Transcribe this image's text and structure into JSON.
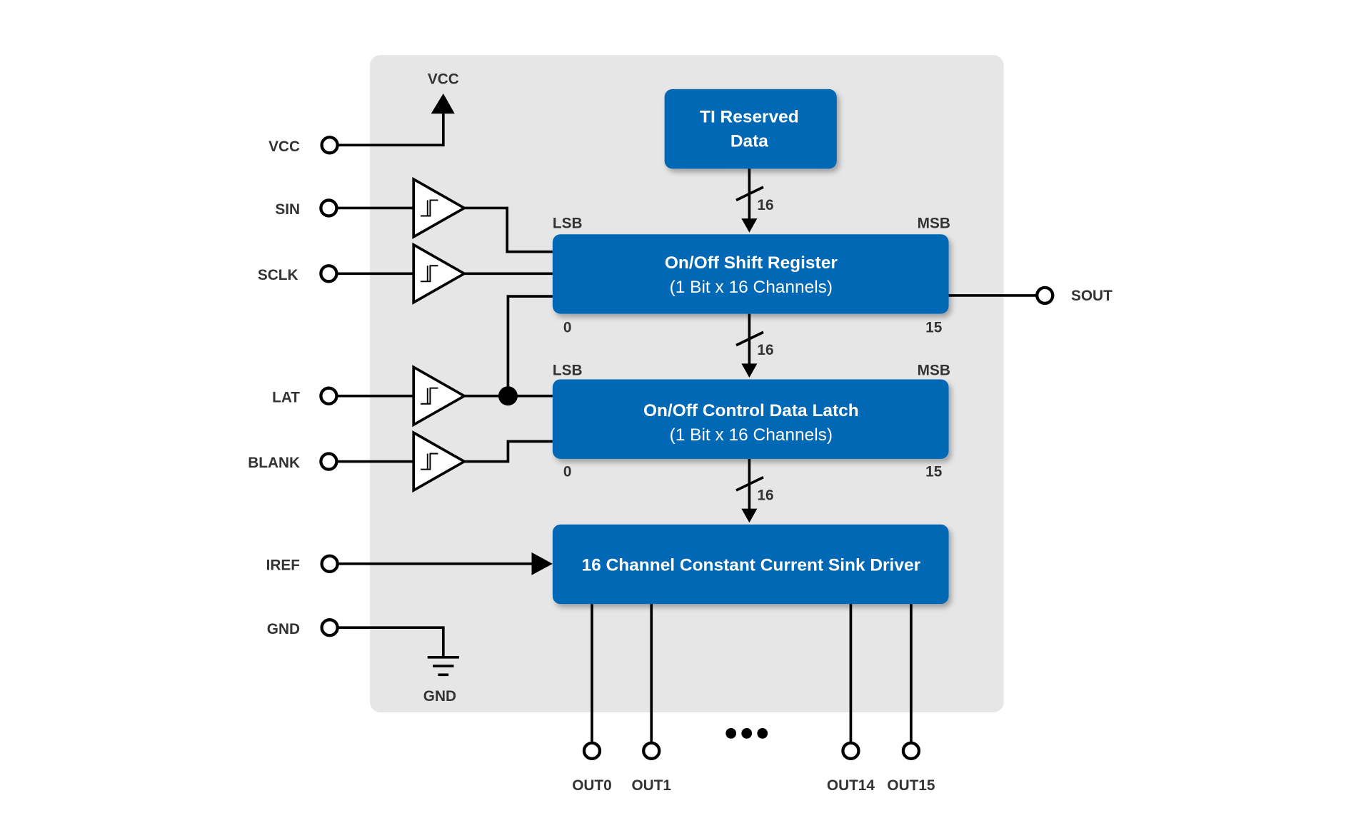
{
  "colors": {
    "block_fill": "#0067b5",
    "panel_fill": "#e6e6e6",
    "wire": "#000000",
    "label": "#333333"
  },
  "pins_left": {
    "vcc": "VCC",
    "sin": "SIN",
    "sclk": "SCLK",
    "lat": "LAT",
    "blank": "BLANK",
    "iref": "IREF",
    "gnd": "GND"
  },
  "internal": {
    "vcc": "VCC",
    "gnd": "GND"
  },
  "pins_right": {
    "sout": "SOUT"
  },
  "outputs": [
    "OUT0",
    "OUT1",
    "OUT14",
    "OUT15"
  ],
  "blocks": {
    "reserved": {
      "line1": "TI Reserved",
      "line2": "Data"
    },
    "shift": {
      "line1": "On/Off Shift Register",
      "line2": "(1 Bit x 16 Channels)",
      "lsb": "LSB",
      "msb": "MSB",
      "bit0": "0",
      "bit15": "15"
    },
    "latch": {
      "line1": "On/Off Control Data Latch",
      "line2": "(1 Bit x 16 Channels)",
      "lsb": "LSB",
      "msb": "MSB",
      "bit0": "0",
      "bit15": "15"
    },
    "driver": {
      "line1": "16 Channel Constant Current Sink Driver"
    }
  },
  "bus_width": "16",
  "buffer_icon": "schmitt-trigger-buffer"
}
